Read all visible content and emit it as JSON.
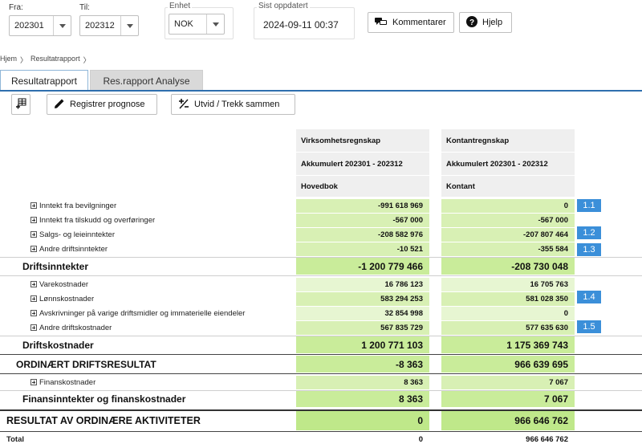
{
  "filters": {
    "from": {
      "label": "Fra:",
      "value": "202301"
    },
    "to": {
      "label": "Til:",
      "value": "202312"
    },
    "unit": {
      "legend": "Enhet",
      "value": "NOK"
    },
    "updated": {
      "legend": "Sist oppdatert",
      "value": "2024-09-11 00:37"
    }
  },
  "buttons": {
    "comments": "Kommentarer",
    "help": "Hjelp",
    "register_forecast": "Registrer prognose",
    "expand_collapse": "Utvid / Trekk sammen"
  },
  "breadcrumb": {
    "home": "Hjem",
    "current": "Resultatrapport",
    "sep": "〉"
  },
  "tabs": {
    "active": "Resultatrapport",
    "other": "Res.rapport Analyse"
  },
  "columns": {
    "a": {
      "title": "Virksomhetsregnskap",
      "period": "Akkumulert 202301 - 202312",
      "sub": "Hovedbok"
    },
    "b": {
      "title": "Kontantregnskap",
      "period": "Akkumulert 202301 - 202312",
      "sub": "Kontant"
    }
  },
  "rows": {
    "inntekt_bevilgninger": {
      "label": "Inntekt fra bevilgninger",
      "a": "-991 618 969",
      "b": "0",
      "badge": "1.1"
    },
    "inntekt_tilskudd": {
      "label": "Inntekt fra tilskudd og overføringer",
      "a": "-567 000",
      "b": "-567 000"
    },
    "salgs_leie": {
      "label": "Salgs- og leieinntekter",
      "a": "-208 582 976",
      "b": "-207 807 464",
      "badge": "1.2"
    },
    "andre_driftsinntekter": {
      "label": "Andre driftsinntekter",
      "a": "-10 521",
      "b": "-355 584",
      "badge": "1.3"
    },
    "driftsinntekter": {
      "label": "Driftsinntekter",
      "a": "-1 200 779 466",
      "b": "-208 730 048"
    },
    "varekostnader": {
      "label": "Varekostnader",
      "a": "16 786 123",
      "b": "16 705 763"
    },
    "lonnskostnader": {
      "label": "Lønnskostnader",
      "a": "583 294 253",
      "b": "581 028 350",
      "badge": "1.4"
    },
    "avskrivninger": {
      "label": "Avskrivninger på varige driftsmidler og immaterielle eiendeler",
      "a": "32 854 998",
      "b": "0"
    },
    "andre_driftskostnader": {
      "label": "Andre driftskostnader",
      "a": "567 835 729",
      "b": "577 635 630",
      "badge": "1.5"
    },
    "driftskostnader": {
      "label": "Driftskostnader",
      "a": "1 200 771 103",
      "b": "1 175 369 743"
    },
    "ordinaert_driftsresultat": {
      "label": "ORDINÆRT DRIFTSRESULTAT",
      "a": "-8 363",
      "b": "966 639 695"
    },
    "finanskostnader": {
      "label": "Finanskostnader",
      "a": "8 363",
      "b": "7 067"
    },
    "finansinntekter_og_kostnader": {
      "label": "Finansinntekter og finanskostnader",
      "a": "8 363",
      "b": "7 067"
    },
    "resultat_ordinaere": {
      "label": "RESULTAT AV ORDINÆRE AKTIVITETER",
      "a": "0",
      "b": "966 646 762"
    },
    "total": {
      "label": "Total",
      "a": "0",
      "b": "966 646 762"
    }
  },
  "icons": {
    "add_column": "add-column-icon",
    "pencil": "pencil-icon",
    "expand": "expand-collapse-icon",
    "comments": "comments-icon",
    "help": "help-icon",
    "dropdown": "chevron-down-icon"
  },
  "colors": {
    "accent": "#2f6fae",
    "badge": "#3b8fd9",
    "cell_green": "#d8f0b4",
    "sum_green": "#c9ec9a"
  }
}
